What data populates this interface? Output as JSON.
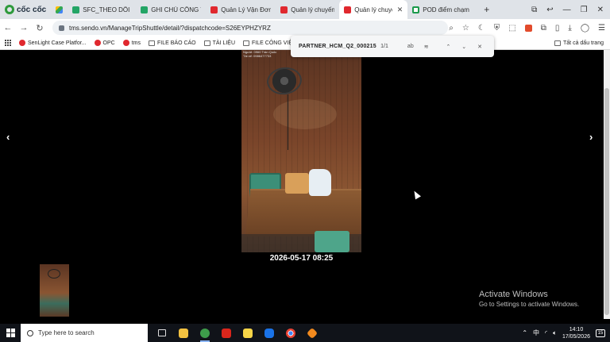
{
  "browser": {
    "brand": "cốc cốc",
    "tabs": [
      {
        "label": "",
        "icon": "drive-icon"
      },
      {
        "label": "SFC_THEO DÕI ĐỐI",
        "icon": "sheets-icon"
      },
      {
        "label": "GHI CHÚ CÔNG VIỆ",
        "icon": "sheets-icon"
      },
      {
        "label": "Quản Lý Vận Đơn C",
        "icon": "sendo-icon"
      },
      {
        "label": "Quản lý chuyến xe",
        "icon": "sendo-icon"
      },
      {
        "label": "Quản lý chuyế",
        "icon": "sendo-icon",
        "active": true
      },
      {
        "label": "POD điểm chạm",
        "icon": "pod-icon"
      }
    ],
    "new_tab_label": "+",
    "url": "tms.sendo.vn/ManageTripShuttle/detail/?dispatchcode=S26EYPHZYRZ"
  },
  "bookmarks": {
    "items": [
      {
        "label": "SenLight Case Platfor...",
        "icon": "sendo-icon"
      },
      {
        "label": "OPC",
        "icon": "sendo-icon"
      },
      {
        "label": "tms",
        "icon": "sendo-icon"
      },
      {
        "label": "FILE BÁO CÁO",
        "icon": "folder-icon"
      },
      {
        "label": "TÀI LIỆU",
        "icon": "folder-icon"
      },
      {
        "label": "FILE CÔNG VIỆC",
        "icon": "folder-icon"
      }
    ],
    "all_bookmarks": "Tất cả dấu trang"
  },
  "find_bar": {
    "query": "PARTNER_HCM_Q2_000215",
    "count": "1/1",
    "case_label": "ab"
  },
  "viewer": {
    "prev_arrow": "‹",
    "next_arrow": "›",
    "photo_stamp_1": "Người: 0960 Trần Quốc",
    "photo_stamp_2": "Tài xế: 0986477733",
    "timestamp": "2026-05-17 08:25"
  },
  "watermark": {
    "title": "Activate Windows",
    "subtitle": "Go to Settings to activate Windows."
  },
  "taskbar": {
    "search_placeholder": "Type here to search",
    "time": "14:10",
    "date": "17/05/2026",
    "notification_count": "15"
  }
}
